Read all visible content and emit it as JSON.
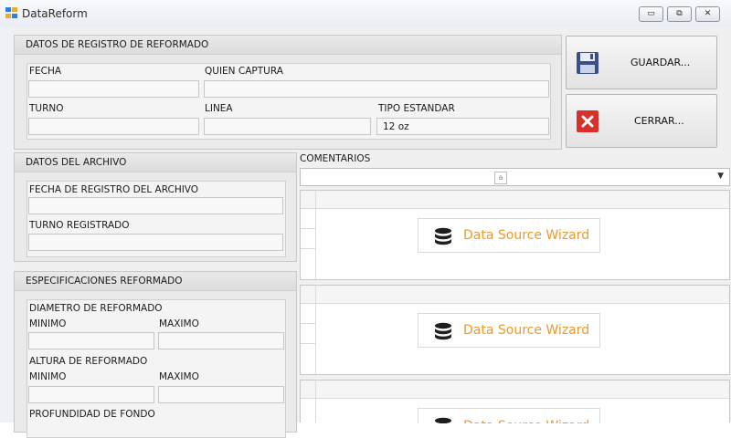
{
  "window": {
    "title": "DataReform",
    "controls": {
      "minimize": "▭",
      "restore": "⧉",
      "close": "✕"
    }
  },
  "registro": {
    "header": "DATOS DE REGISTRO DE REFORMADO",
    "fecha_label": "FECHA",
    "fecha_value": "",
    "quien_label": "QUIEN CAPTURA",
    "quien_value": "",
    "turno_label": "TURNO",
    "turno_value": "",
    "linea_label": "LINEA",
    "linea_value": "",
    "tipo_label": "TIPO ESTANDAR",
    "tipo_value": "12 oz"
  },
  "buttons": {
    "guardar": "GUARDAR...",
    "cerrar": "CERRAR..."
  },
  "archivo": {
    "header": "DATOS DEL ARCHIVO",
    "fecha_registro_label": "FECHA DE REGISTRO DEL ARCHIVO",
    "fecha_registro_value": "",
    "turno_registrado_label": "TURNO REGISTRADO",
    "turno_registrado_value": ""
  },
  "comentarios": {
    "label": "COMENTARIOS",
    "combo_icon": "a"
  },
  "especificaciones": {
    "header": "ESPECIFICACIONES REFORMADO",
    "diametro_label": "DIAMETRO DE REFORMADO",
    "altura_label": "ALTURA DE REFORMADO",
    "profundidad_label": "PROFUNDIDAD DE FONDO",
    "minimo_label": "MINIMO",
    "maximo_label": "MAXIMO"
  },
  "grids": {
    "wizard_label": "Data Source Wizard",
    "wizard_icon": "database-icon",
    "accent": "#f0982a"
  },
  "colors": {
    "save_icon": "#3a4f8a",
    "close_icon": "#d9302a"
  }
}
